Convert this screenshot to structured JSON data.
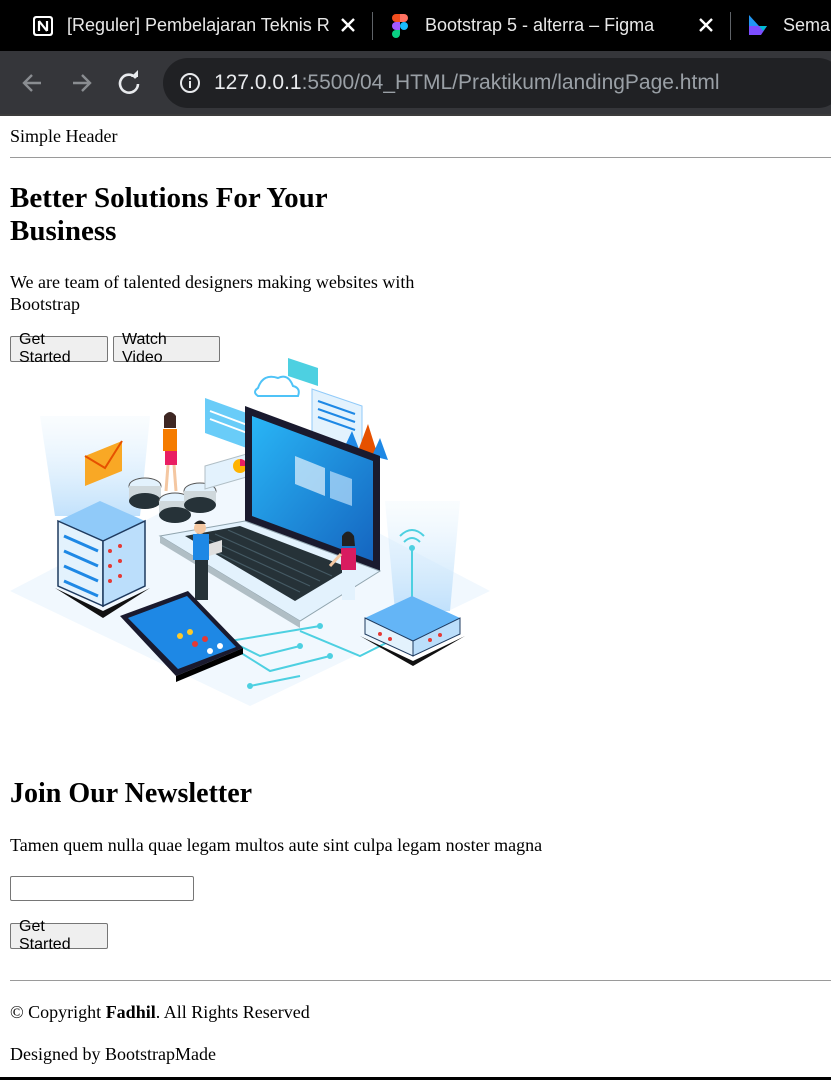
{
  "browser": {
    "tabs": [
      {
        "title": "[Reguler] Pembelajaran Teknis Re",
        "icon": "notion-icon"
      },
      {
        "title": "Bootstrap 5 - alterra – Figma",
        "icon": "figma-icon"
      },
      {
        "title": "Semar",
        "icon": "app-logo-icon"
      }
    ],
    "url_host": "127.0.0.1",
    "url_path": ":5500/04_HTML/Praktikum/landingPage.html"
  },
  "page": {
    "header": "Simple Header",
    "hero": {
      "title": "Better Solutions For Your Business",
      "text": "We are team of talented designers making websites with Bootstrap",
      "primary_button": "Get Started",
      "secondary_button": "Watch Video"
    },
    "newsletter": {
      "title": "Join Our Newsletter",
      "text": "Tamen quem nulla quae legam multos aute sint culpa legam noster magna",
      "input_value": "",
      "button": "Get Started"
    },
    "footer": {
      "copyright_prefix": "© Copyright ",
      "copyright_name": "Fadhil",
      "copyright_suffix": ". All Rights Reserved",
      "designed_by": "Designed by BootstrapMade"
    }
  },
  "colors": {
    "tabbar_bg": "#000000",
    "toolbar_bg": "#35363a",
    "omnibox_bg": "#202124",
    "illustration_blue": "#1e88e5",
    "illustration_cyan": "#4dd0e1"
  }
}
